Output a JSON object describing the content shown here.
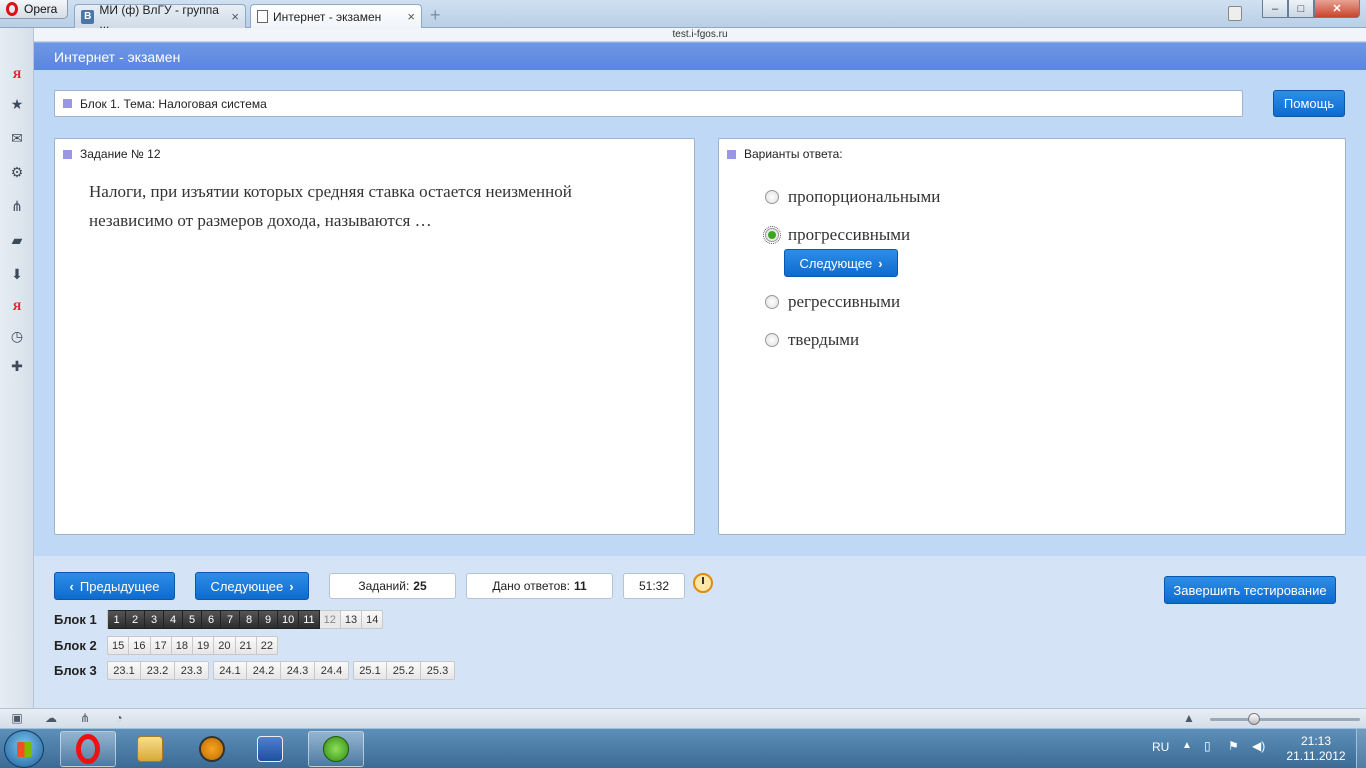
{
  "browser": {
    "menu_label": "Opera",
    "tabs": [
      {
        "label": "МИ (ф) ВлГУ - группа ...",
        "icon": "vk-icon",
        "favicon_text": "B"
      },
      {
        "label": "Интернет - экзамен",
        "icon": "document-icon"
      }
    ],
    "tab_close": "×",
    "new_tab": "+",
    "url": "test.i-fgos.ru",
    "window_controls": {
      "minimize": "–",
      "maximize": "□",
      "close": "✕"
    }
  },
  "sidebar": {
    "icons": [
      "yandex-icon",
      "star-icon",
      "mail-icon",
      "gear-icon",
      "unite-icon",
      "notes-icon",
      "download-icon",
      "yandex-bar-icon",
      "history-icon",
      "add-panel-icon"
    ]
  },
  "page": {
    "header_title": "Интернет - экзамен",
    "topic": "Блок 1. Тема: Налоговая система",
    "help_button": "Помощь",
    "task": {
      "title": "Задание № 12",
      "text": "Налоги, при изъятии которых средняя ставка остается неизменной независимо от размеров дохода, называются …"
    },
    "answers": {
      "title": "Варианты ответа:",
      "options": [
        {
          "label": "пропорциональными",
          "selected": false
        },
        {
          "label": "прогрессивными",
          "selected": true
        },
        {
          "label": "регрессивными",
          "selected": false
        },
        {
          "label": "твердыми",
          "selected": false
        }
      ],
      "next_inline": "Следующее"
    }
  },
  "footer": {
    "prev_button": "Предыдущее",
    "next_button": "Следующее",
    "tasks_label": "Заданий:",
    "tasks_count": "25",
    "answered_label": "Дано ответов:",
    "answered_count": "11",
    "timer": "51:32",
    "finish_button": "Завершить тестирование",
    "blocks": [
      {
        "label": "Блок 1",
        "groups": [
          [
            "1",
            "2",
            "3",
            "4",
            "5",
            "6",
            "7",
            "8",
            "9",
            "10",
            "11",
            "12",
            "13",
            "14"
          ]
        ]
      },
      {
        "label": "Блок 2",
        "groups": [
          [
            "15",
            "16",
            "17",
            "18",
            "19",
            "20",
            "21",
            "22"
          ]
        ]
      },
      {
        "label": "Блок 3",
        "groups": [
          [
            "23.1",
            "23.2",
            "23.3"
          ],
          [
            "24.1",
            "24.2",
            "24.3",
            "24.4"
          ],
          [
            "25.1",
            "25.2",
            "25.3"
          ]
        ]
      }
    ],
    "done_cells": [
      "1",
      "2",
      "3",
      "4",
      "5",
      "6",
      "7",
      "8",
      "9",
      "10",
      "11"
    ],
    "current_cell": "12"
  },
  "statusbar": {
    "icons": [
      "panel-toggle-icon",
      "cloud-icon",
      "unite-icon",
      "turbo-icon"
    ],
    "zoom_percent": 100
  },
  "taskbar": {
    "apps": [
      "opera-icon",
      "explorer-icon",
      "aimp-icon",
      "word-icon",
      "network-icon"
    ],
    "language": "RU",
    "time": "21:13",
    "date": "21.11.2012"
  },
  "colors": {
    "accent": "#0d6bcf",
    "header": "#5a86df",
    "selected_radio": "#3aa61d",
    "done_cell": "#2c2c2c"
  }
}
